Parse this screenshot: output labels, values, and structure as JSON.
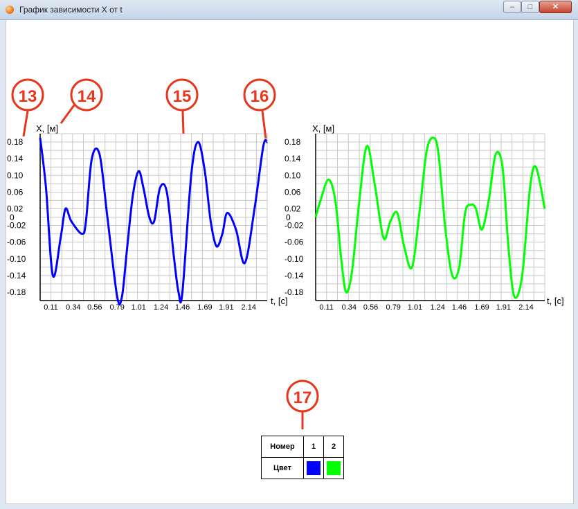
{
  "window": {
    "title": "График зависимости X от t",
    "buttons": {
      "minimize": "–",
      "maximize": "□",
      "close": "✕"
    }
  },
  "callouts": [
    "13",
    "14",
    "15",
    "16",
    "17"
  ],
  "legend": {
    "header_label": "Номер",
    "color_label": "Цвет",
    "entries": [
      {
        "number": "1",
        "color": "#0000ff"
      },
      {
        "number": "2",
        "color": "#00ff00"
      }
    ]
  },
  "chart_data": [
    {
      "type": "line",
      "xlabel": "t, [с]",
      "ylabel": "X, [м]",
      "xlim": [
        0,
        2.33
      ],
      "ylim": [
        -0.2,
        0.2
      ],
      "xticks": [
        "0.11",
        "0.34",
        "0.56",
        "0.79",
        "1.01",
        "1.24",
        "1.46",
        "1.69",
        "1.91",
        "2.14"
      ],
      "yticks": [
        "0.18",
        "0.14",
        "0.10",
        "0.06",
        "0.02",
        "-0.02",
        "-0.06",
        "-0.10",
        "-0.14",
        "-0.18"
      ],
      "zero_label": "0",
      "grid": true,
      "series": [
        {
          "color": "#0000ff",
          "x": [
            0.0,
            0.06,
            0.13,
            0.21,
            0.26,
            0.32,
            0.43,
            0.47,
            0.53,
            0.61,
            0.69,
            0.79,
            0.84,
            0.89,
            0.95,
            1.01,
            1.06,
            1.12,
            1.17,
            1.23,
            1.3,
            1.37,
            1.42,
            1.46,
            1.55,
            1.62,
            1.69,
            1.75,
            1.81,
            1.87,
            1.92,
            2.01,
            2.1,
            2.2,
            2.29,
            2.33
          ],
          "y": [
            0.19,
            0.07,
            -0.14,
            -0.05,
            0.02,
            -0.01,
            -0.04,
            -0.01,
            0.14,
            0.15,
            0.0,
            -0.19,
            -0.19,
            -0.08,
            0.05,
            0.11,
            0.07,
            0.0,
            -0.01,
            0.07,
            0.06,
            -0.09,
            -0.18,
            -0.18,
            0.1,
            0.18,
            0.11,
            -0.01,
            -0.07,
            -0.04,
            0.01,
            -0.03,
            -0.11,
            0.02,
            0.17,
            0.18
          ]
        }
      ]
    },
    {
      "type": "line",
      "xlabel": "t, [с]",
      "ylabel": "X, [м]",
      "xlim": [
        0,
        2.33
      ],
      "ylim": [
        -0.2,
        0.2
      ],
      "xticks": [
        "0.11",
        "0.34",
        "0.56",
        "0.79",
        "1.01",
        "1.24",
        "1.46",
        "1.69",
        "1.91",
        "2.14"
      ],
      "yticks": [
        "0.18",
        "0.14",
        "0.10",
        "0.06",
        "0.02",
        "-0.02",
        "-0.06",
        "-0.10",
        "-0.14",
        "-0.18"
      ],
      "zero_label": "0",
      "grid": true,
      "series": [
        {
          "color": "#00ff00",
          "x": [
            0.0,
            0.05,
            0.13,
            0.2,
            0.26,
            0.31,
            0.37,
            0.44,
            0.52,
            0.6,
            0.69,
            0.76,
            0.83,
            0.9,
            0.98,
            1.06,
            1.13,
            1.2,
            1.25,
            1.32,
            1.39,
            1.46,
            1.52,
            1.58,
            1.63,
            1.69,
            1.76,
            1.83,
            1.9,
            1.96,
            2.02,
            2.1,
            2.18,
            2.24,
            2.33
          ],
          "y": [
            0.0,
            0.04,
            0.09,
            0.04,
            -0.1,
            -0.18,
            -0.13,
            0.03,
            0.17,
            0.08,
            -0.05,
            -0.01,
            0.01,
            -0.07,
            -0.12,
            0.02,
            0.16,
            0.19,
            0.15,
            -0.03,
            -0.14,
            -0.12,
            0.01,
            0.03,
            0.02,
            -0.03,
            0.04,
            0.15,
            0.12,
            -0.07,
            -0.19,
            -0.14,
            0.07,
            0.12,
            0.02
          ]
        }
      ]
    }
  ]
}
